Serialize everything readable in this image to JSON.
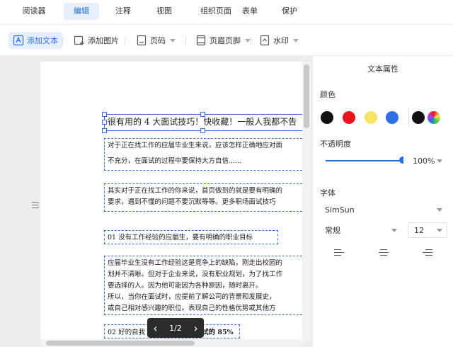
{
  "menu": {
    "tabs": [
      {
        "label": "阅读器"
      },
      {
        "label": "编辑"
      },
      {
        "label": "注释"
      },
      {
        "label": "视图"
      },
      {
        "label": "组织页面"
      },
      {
        "label": "表单"
      },
      {
        "label": "保护"
      }
    ],
    "active": "编辑"
  },
  "toolbar": {
    "add_text": "添加文本",
    "add_image": "添加图片",
    "page_number": "页码",
    "header_footer": "页眉页脚",
    "watermark": "水印"
  },
  "document": {
    "title_line": "很有用的 4 大面试技巧！快收藏！一般人我都不告",
    "para1": [
      "对于正在找工作的应届毕业生来说，应该怎样正确地应对面",
      "不充分，在面试的过程中要保持大方自信......"
    ],
    "para2": [
      "其实对于正在找工作的你来说，首页做到的就是要有明确的",
      "要求，遇到不懂的问题不要沉默等等。更多职场面试技巧"
    ],
    "heading1": "01 没有工作经验的应届生，要有明确的职业目标",
    "para3": [
      "应届毕业生没有工作经验这是竞争上的缺陷，刚走出校园的",
      "划并不清晰。但对于企业来说，没有职业规划，为了找工作",
      "要选择的人。因为他可能因为各种原因，随时离开。",
      "所以，当你在面试时，应提前了解公司的背景和发展史，",
      "或自己相对感兴趣的职位。表现自己的性格优势或其他方"
    ],
    "heading2_start": "02 好的自我",
    "heading2_end": "试的 85%"
  },
  "pager": {
    "prev": "‹",
    "label": "1/2",
    "next": "›"
  },
  "panel": {
    "title": "文本属性",
    "color_label": "颜色",
    "colors": [
      "#111111",
      "#e8141b",
      "#f7e463",
      "#2f6fe6",
      "#111111"
    ],
    "opacity_label": "不透明度",
    "opacity_value": "100%",
    "opacity_fraction": 1.0,
    "font_label": "字体",
    "font_family": "SimSun",
    "font_style": "常规",
    "font_size": "12"
  }
}
